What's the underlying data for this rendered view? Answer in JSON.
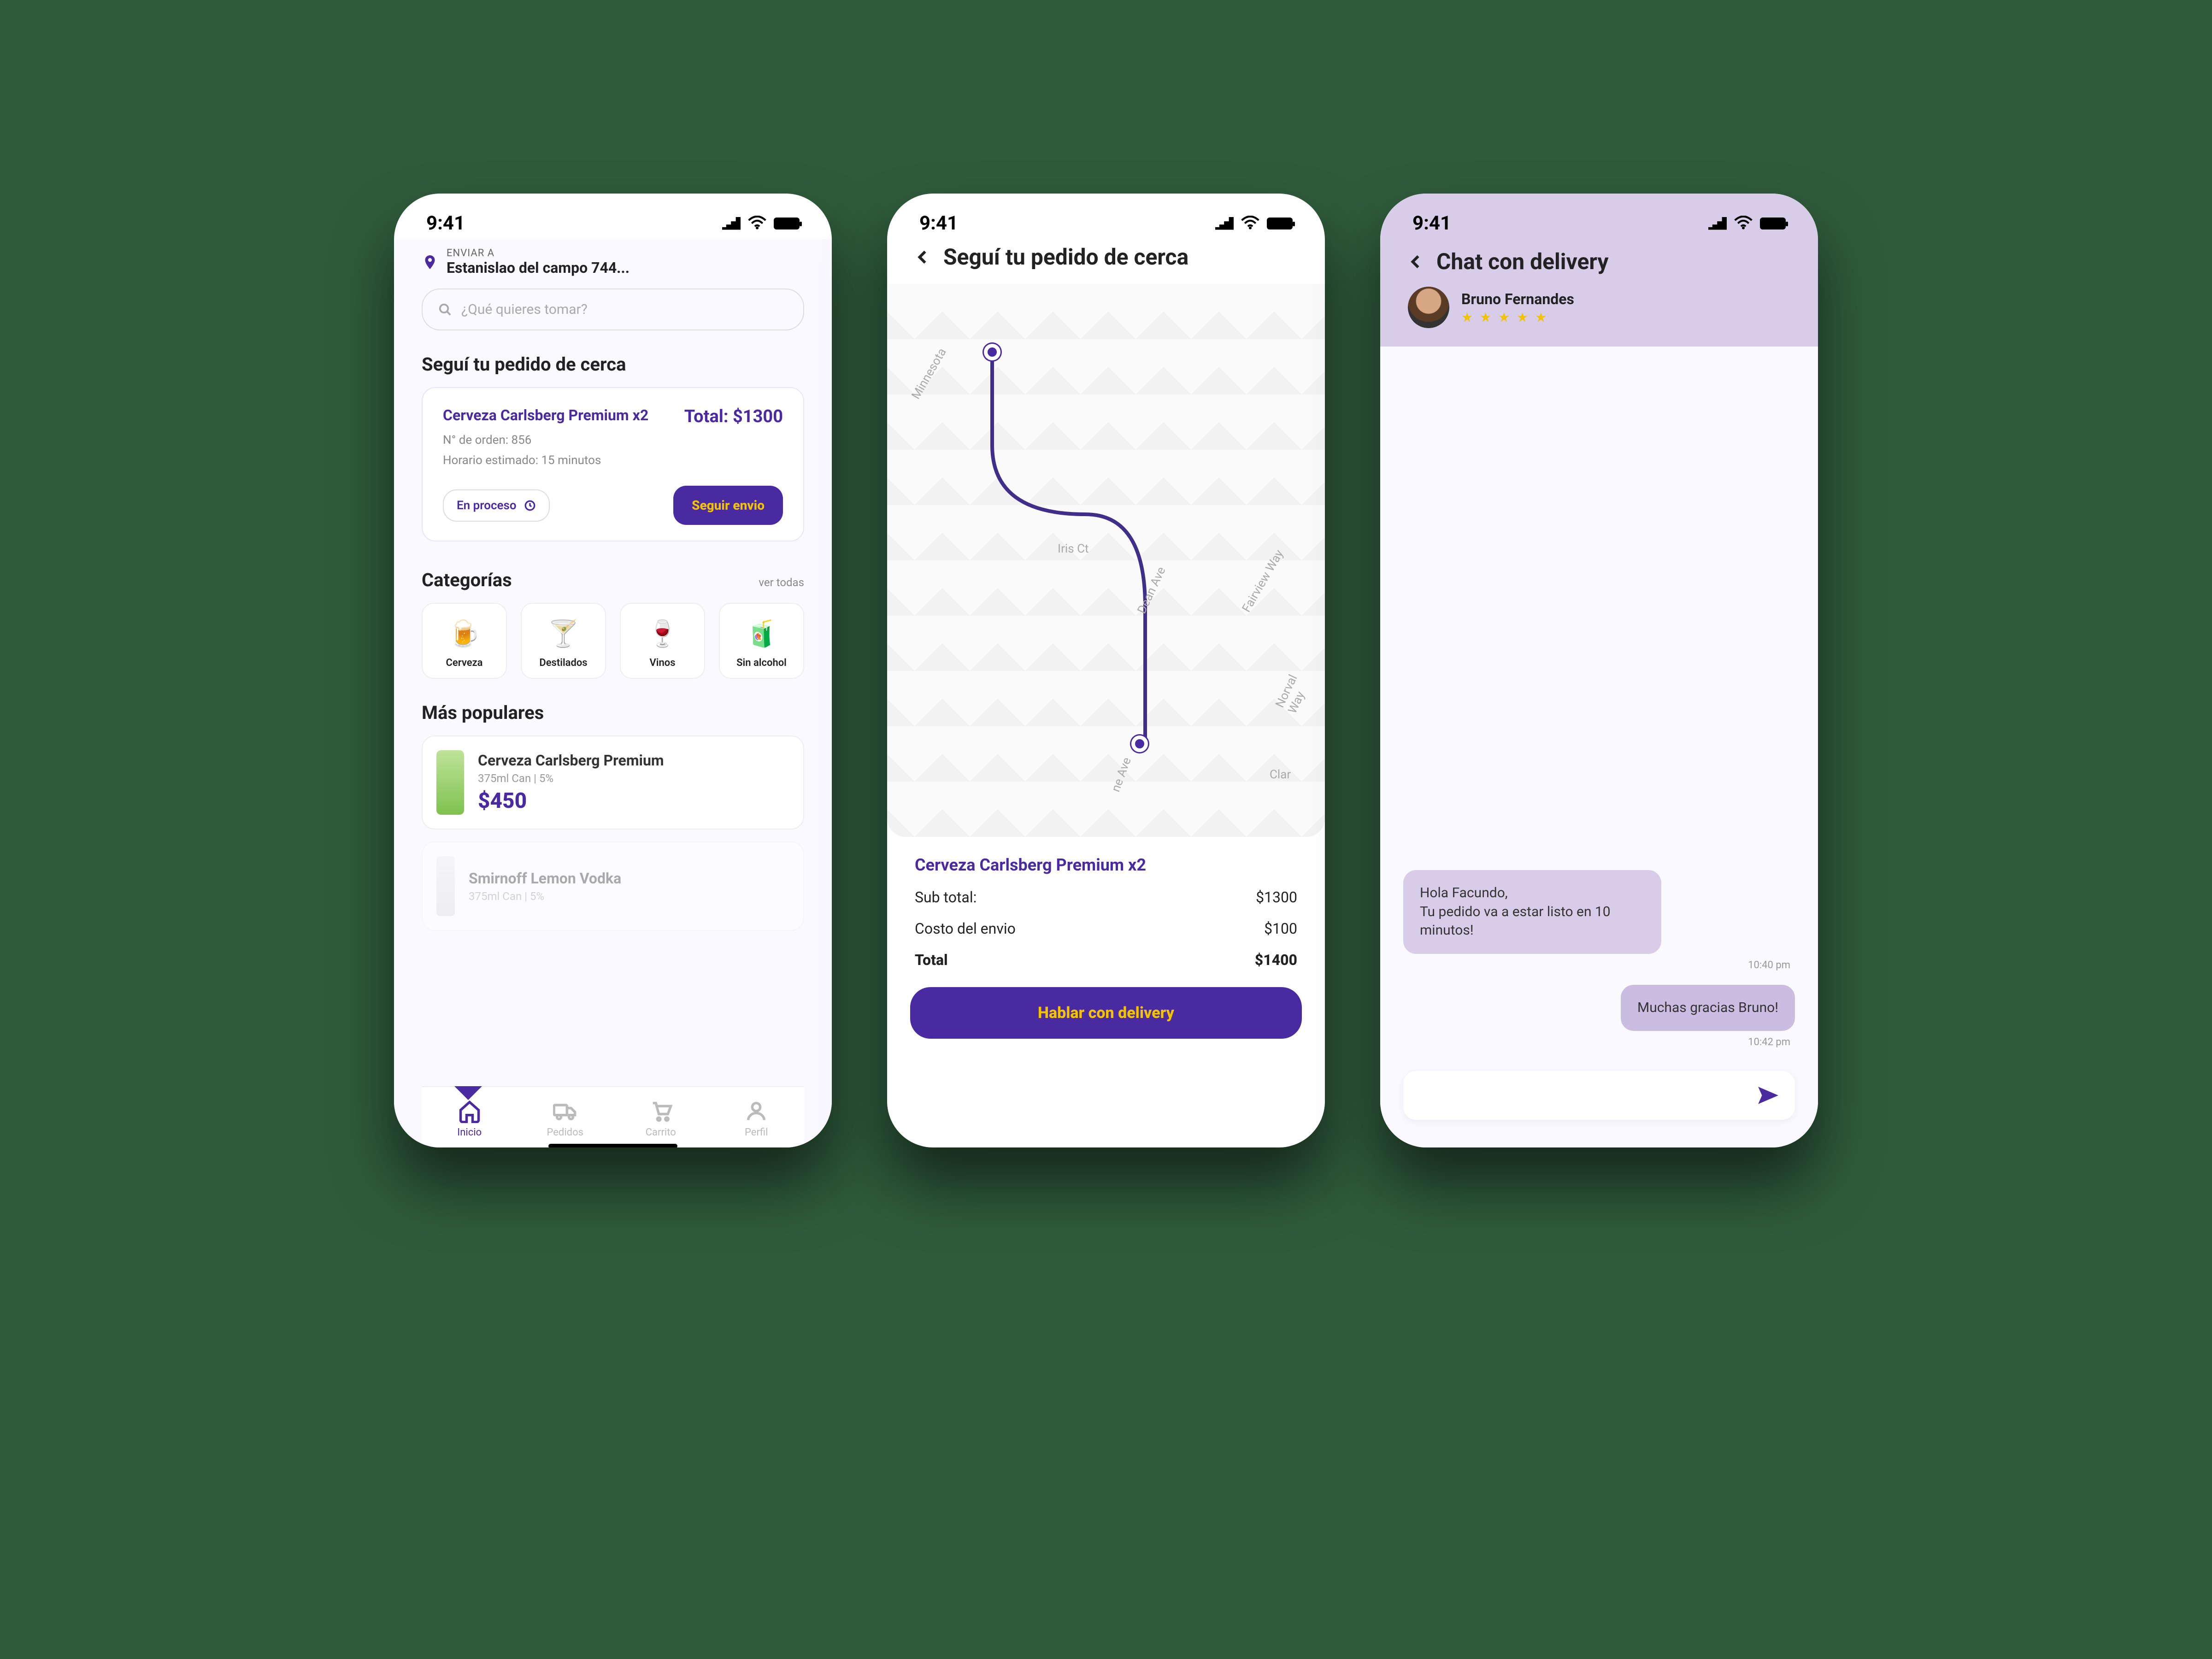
{
  "status_time": "9:41",
  "screen1": {
    "enviar_a_label": "ENVIAR A",
    "address": "Estanislao del campo 744...",
    "search_placeholder": "¿Qué quieres tomar?",
    "follow_title": "Seguí tu pedido de cerca",
    "order": {
      "title": "Cerveza Carlsberg Premium x2",
      "total_label": "Total: $1300",
      "order_no": "N° de orden: 856",
      "eta": "Horario estimado: 15 minutos",
      "status": "En proceso",
      "follow_btn": "Seguir envio"
    },
    "categorias_label": "Categorías",
    "ver_todas": "ver todas",
    "cats": [
      "Cerveza",
      "Destilados",
      "Vinos",
      "Sin alcohol"
    ],
    "populares_label": "Más populares",
    "p1": {
      "name": "Cerveza Carlsberg Premium",
      "meta": "375ml Can  |  5%",
      "price": "$450"
    },
    "p2": {
      "name": "Smirnoff Lemon Vodka",
      "meta": "375ml Can  |  5%"
    },
    "tabs": [
      "Inicio",
      "Pedidos",
      "Carrito",
      "Perfil"
    ]
  },
  "screen2": {
    "title": "Seguí tu pedido de cerca",
    "streets": {
      "s1": "Minnesota",
      "s2": "Iris Ct",
      "s3": "Dean Ave",
      "s4": "Fairview Way",
      "s5": "Norval Way",
      "s6": "ne Ave",
      "s7": "Clar"
    },
    "pname": "Cerveza Carlsberg Premium x2",
    "rows": {
      "sub_label": "Sub total:",
      "sub_val": "$1300",
      "ship_label": "Costo del envio",
      "ship_val": "$100",
      "tot_label": "Total",
      "tot_val": "$1400"
    },
    "talk_btn": "Hablar con delivery"
  },
  "screen3": {
    "title": "Chat con delivery",
    "driver": "Bruno Fernandes",
    "stars": "★ ★ ★ ★ ★",
    "msg1": "Hola Facundo,\nTu pedido va a estar listo en 10 minutos!",
    "time1": "10:40 pm",
    "msg2": "Muchas gracias Bruno!",
    "time2": "10:42 pm",
    "composer_placeholder": ""
  }
}
